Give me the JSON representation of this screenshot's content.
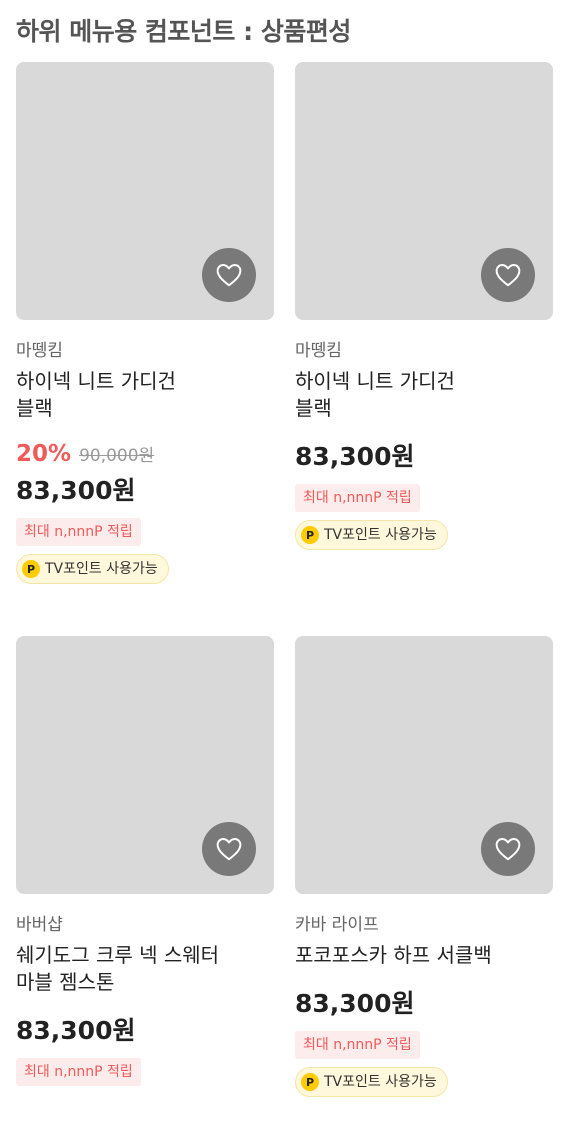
{
  "title": "하위 메뉴용 컴포넌트 : 상품편성",
  "products": [
    {
      "brand": "마뗑킴",
      "name_line1": "하이넥 니트 가디건",
      "name_line2": "블랙",
      "discount": "20%",
      "original_price": "90,000원",
      "price": "83,300원",
      "points": "최대 n,nnnP 적립",
      "tv_point": "TV포인트 사용가능",
      "p_icon": "P"
    },
    {
      "brand": "마뗑킴",
      "name_line1": "하이넥 니트 가디건",
      "name_line2": "블랙",
      "price": "83,300원",
      "points": "최대 n,nnnP 적립",
      "tv_point": "TV포인트 사용가능",
      "p_icon": "P"
    },
    {
      "brand": "바버샵",
      "name_line1": "쉐기도그 크루 넥 스웨터",
      "name_line2": "마블 젬스톤",
      "price": "83,300원",
      "points": "최대 n,nnnP 적립"
    },
    {
      "brand": "카바 라이프",
      "name_line1": "포코포스카 하프 서클백",
      "price": "83,300원",
      "points": "최대 n,nnnP 적립",
      "tv_point": "TV포인트 사용가능",
      "p_icon": "P"
    }
  ],
  "colors": {
    "accent_red": "#f05a5a",
    "thumb_gray": "#d9d9d9",
    "tv_badge_bg": "#fff8dc",
    "p_icon": "#ffcc00"
  },
  "icons": {
    "wishlist": "heart-outline-icon"
  }
}
